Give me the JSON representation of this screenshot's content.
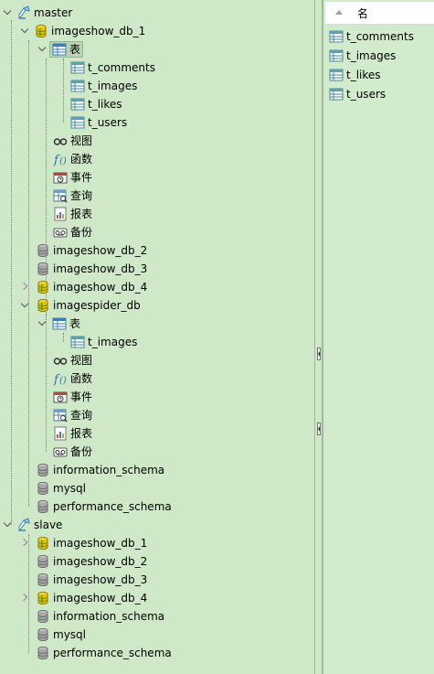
{
  "labels": {
    "table": "表",
    "view": "视图",
    "function": "函数",
    "event": "事件",
    "query": "查询",
    "report": "报表",
    "backup": "备份"
  },
  "tree": {
    "master": {
      "name": "master",
      "databases": {
        "db1": {
          "name": "imageshow_db_1",
          "tables": [
            "t_comments",
            "t_images",
            "t_likes",
            "t_users"
          ]
        },
        "db2": {
          "name": "imageshow_db_2"
        },
        "db3": {
          "name": "imageshow_db_3"
        },
        "db4": {
          "name": "imageshow_db_4"
        },
        "spider": {
          "name": "imagespider_db",
          "tables": [
            "t_images"
          ]
        },
        "info": {
          "name": "information_schema"
        },
        "mysql": {
          "name": "mysql"
        },
        "perf": {
          "name": "performance_schema"
        }
      }
    },
    "slave": {
      "name": "slave",
      "databases": {
        "db1": {
          "name": "imageshow_db_1"
        },
        "db2": {
          "name": "imageshow_db_2"
        },
        "db3": {
          "name": "imageshow_db_3"
        },
        "db4": {
          "name": "imageshow_db_4"
        },
        "info": {
          "name": "information_schema"
        },
        "mysql": {
          "name": "mysql"
        },
        "perf": {
          "name": "performance_schema"
        }
      }
    }
  },
  "object_list": {
    "column_header": "名",
    "items": [
      "t_comments",
      "t_images",
      "t_likes",
      "t_users"
    ]
  },
  "colors": {
    "background": "#cfe8c8",
    "db_active": "#e8c400",
    "db_inactive": "#9a9a9a"
  }
}
